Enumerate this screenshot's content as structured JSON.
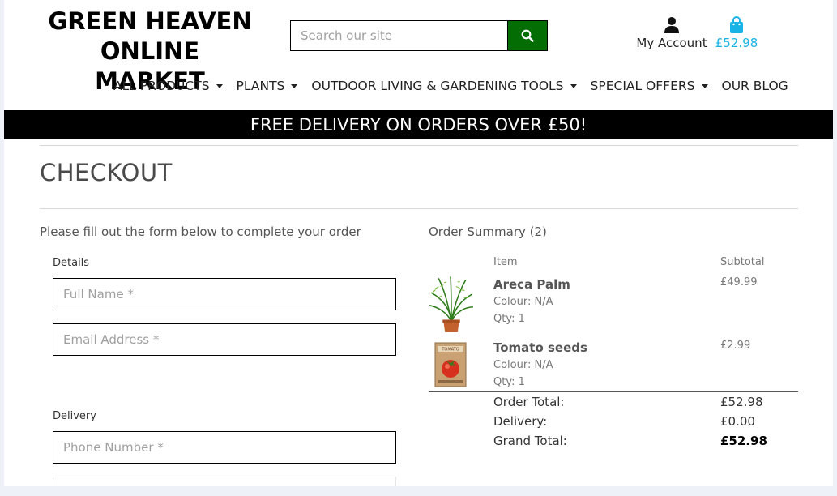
{
  "header": {
    "logo_line1": "GREEN HEAVEN",
    "logo_line2": "ONLINE MARKET",
    "search_placeholder": "Search our site",
    "search_icon": "search-icon",
    "account_label": "My Account",
    "account_icon": "user-icon",
    "bag_total": "£52.98",
    "bag_icon": "shopping-bag-icon",
    "accent_color": "#19b3e6",
    "search_button_color": "#046d04"
  },
  "nav": [
    {
      "label": "ALL PRODUCTS",
      "dropdown": true
    },
    {
      "label": "PLANTS",
      "dropdown": true
    },
    {
      "label": "OUTDOOR LIVING & GARDENING TOOLS",
      "dropdown": true
    },
    {
      "label": "SPECIAL OFFERS",
      "dropdown": true
    },
    {
      "label": "OUR BLOG",
      "dropdown": false
    }
  ],
  "banner": "FREE DELIVERY ON ORDERS OVER £50!",
  "checkout": {
    "title": "CHECKOUT",
    "subtitle": "Please fill out the form below to complete your order",
    "details_label": "Details",
    "full_name_placeholder": "Full Name *",
    "email_placeholder": "Email Address *",
    "delivery_label": "Delivery",
    "phone_placeholder": "Phone Number *"
  },
  "summary": {
    "title": "Order Summary (2)",
    "col_item": "Item",
    "col_subtotal": "Subtotal",
    "items": [
      {
        "name": "Areca Palm",
        "colour": "Colour: N/A",
        "qty": "Qty: 1",
        "price": "£49.99",
        "image": "palm-plant-image"
      },
      {
        "name": "Tomato seeds",
        "colour": "Colour: N/A",
        "qty": "Qty: 1",
        "price": "£2.99",
        "image": "tomato-seed-packet-image"
      }
    ],
    "order_total_label": "Order Total:",
    "order_total": "£52.98",
    "delivery_label": "Delivery:",
    "delivery": "£0.00",
    "grand_total_label": "Grand Total:",
    "grand_total": "£52.98"
  }
}
